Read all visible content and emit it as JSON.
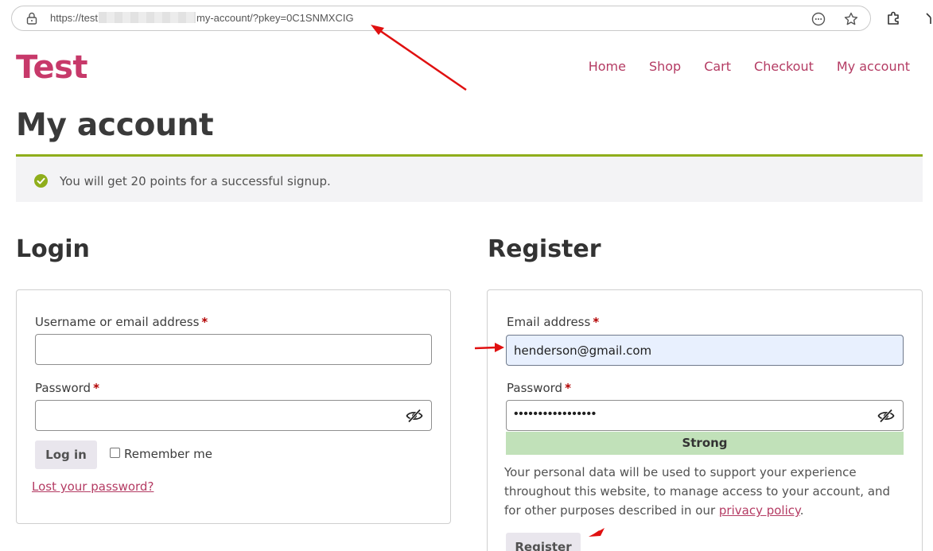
{
  "browser": {
    "url_prefix": "https://test",
    "url_suffix": "my-account/?pkey=0C1SNMXCIG",
    "icons": [
      "lock-icon",
      "reader-mode-icon",
      "favorite-star-icon",
      "extensions-icon"
    ]
  },
  "site": {
    "title": "Test",
    "nav": [
      "Home",
      "Shop",
      "Cart",
      "Checkout",
      "My account"
    ]
  },
  "page": {
    "title": "My account",
    "notice": "You will get 20 points for a successful signup."
  },
  "login": {
    "heading": "Login",
    "username_label": "Username or email address",
    "password_label": "Password",
    "required_mark": "*",
    "login_button": "Log in",
    "remember_label": "Remember me",
    "lost_password": "Lost your password?"
  },
  "register": {
    "heading": "Register",
    "email_label": "Email address",
    "email_value": "henderson@gmail.com",
    "password_label": "Password",
    "password_mask": "•••••••••••••••••",
    "required_mark": "*",
    "strength": "Strong",
    "privacy_text": "Your personal data will be used to support your experience throughout this website, to manage access to your account, and for other purposes described in our ",
    "privacy_link": "privacy policy",
    "privacy_end": ".",
    "register_button": "Register"
  },
  "colors": {
    "brand": "#c7396a",
    "nav_link": "#b43b63",
    "notice_border": "#8fae1b",
    "notice_icon": "#8fae1b",
    "strength_bg": "#c1e1b9",
    "annotation_arrow": "#e01010"
  }
}
